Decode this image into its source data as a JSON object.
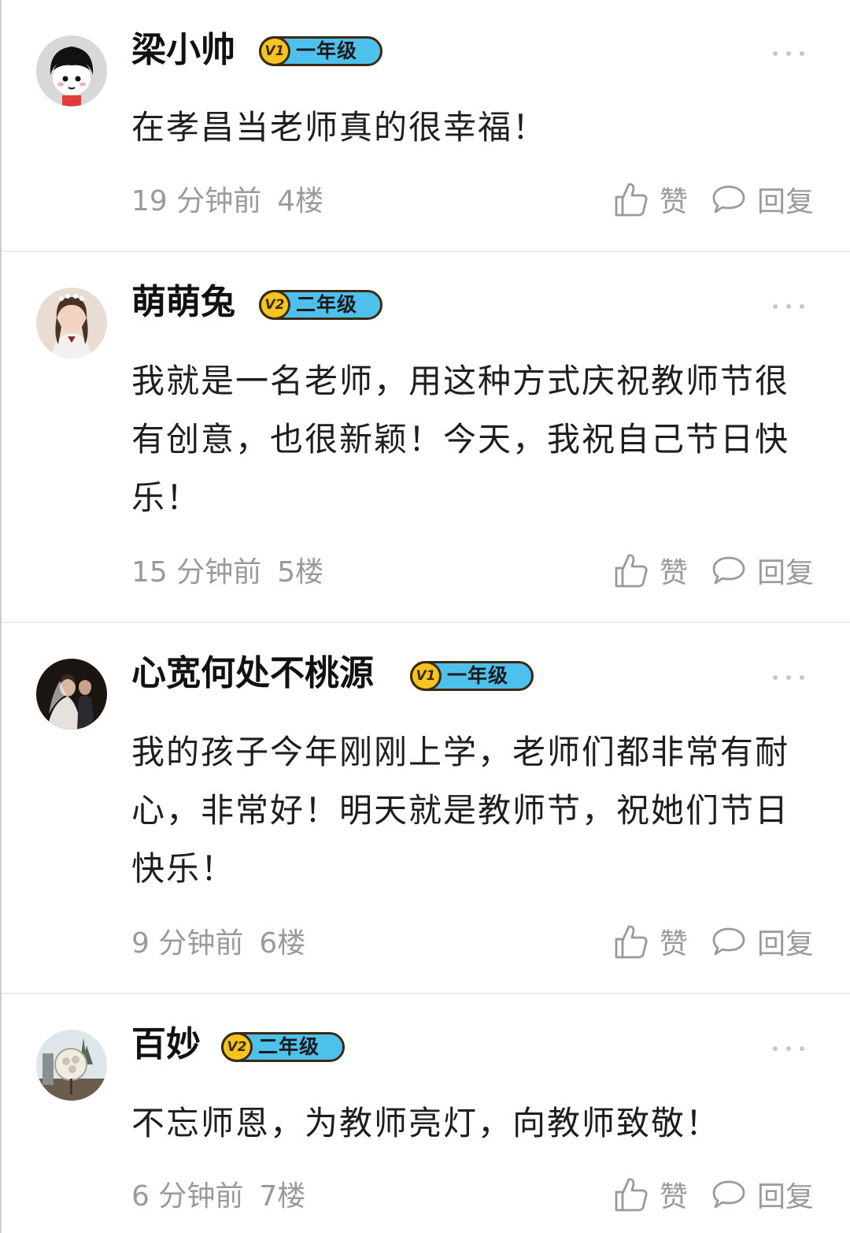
{
  "actions": {
    "like_label": "赞",
    "reply_label": "回复"
  },
  "comments": [
    {
      "user": "梁小帅",
      "badge": {
        "mark": "V1",
        "level": "一年级"
      },
      "text": "在孝昌当老师真的很幸福！",
      "time": "19 分钟前",
      "floor": "4楼"
    },
    {
      "user": "萌萌兔",
      "badge": {
        "mark": "V2",
        "level": "二年级"
      },
      "text": "我就是一名老师，用这种方式庆祝教师节很有创意，也很新颖！今天，我祝自己节日快乐！",
      "time": "15 分钟前",
      "floor": "5楼"
    },
    {
      "user": "心宽何处不桃源",
      "badge": {
        "mark": "V1",
        "level": "一年级"
      },
      "text": "我的孩子今年刚刚上学，老师们都非常有耐心，非常好！明天就是教师节，祝她们节日快乐！",
      "time": "9 分钟前",
      "floor": "6楼"
    },
    {
      "user": "百妙",
      "badge": {
        "mark": "V2",
        "level": "二年级"
      },
      "text": "不忘师恩，为教师亮灯，向教师致敬！",
      "time": "6 分钟前",
      "floor": "7楼"
    }
  ]
}
